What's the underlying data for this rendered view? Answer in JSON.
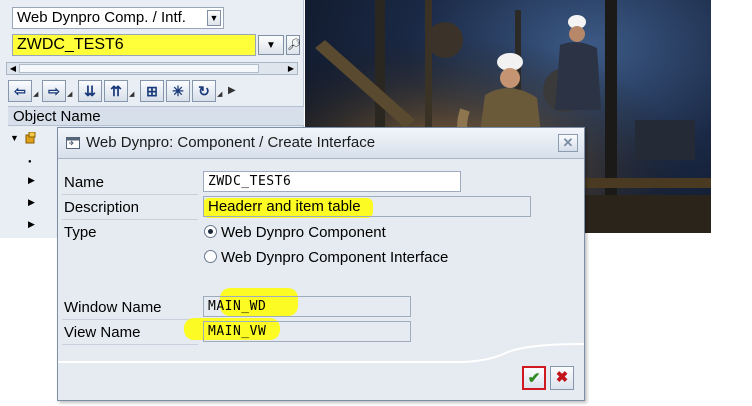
{
  "navigator": {
    "object_type_value": "Web Dynpro Comp. / Intf.",
    "object_name_value": "ZWDC_TEST6",
    "column_header": "Object Name",
    "toolbar_icons": [
      "back-arrow-icon",
      "forward-arrow-icon",
      "collapse-icon",
      "expand-icon",
      "hierarchy-icon",
      "select-all-icon",
      "refresh-icon"
    ]
  },
  "dialog": {
    "title": "Web Dynpro: Component / Create Interface",
    "labels": {
      "name": "Name",
      "description": "Description",
      "type": "Type",
      "window_name": "Window Name",
      "view_name": "View Name"
    },
    "values": {
      "name": "ZWDC_TEST6",
      "description": "Headerr and item table",
      "window_name": "MAIN_WD",
      "view_name": "MAIN_VW"
    },
    "type_options": [
      {
        "label": "Web Dynpro Component",
        "selected": true
      },
      {
        "label": "Web Dynpro Component Interface",
        "selected": false
      }
    ],
    "buttons": {
      "confirm": "confirm-check-icon",
      "cancel": "cancel-x-icon"
    }
  },
  "colors": {
    "highlight": "#ffff00",
    "confirm_green": "#2f8a1f",
    "cancel_red": "#c4141b",
    "dialog_bg": "#e6ebf2"
  }
}
